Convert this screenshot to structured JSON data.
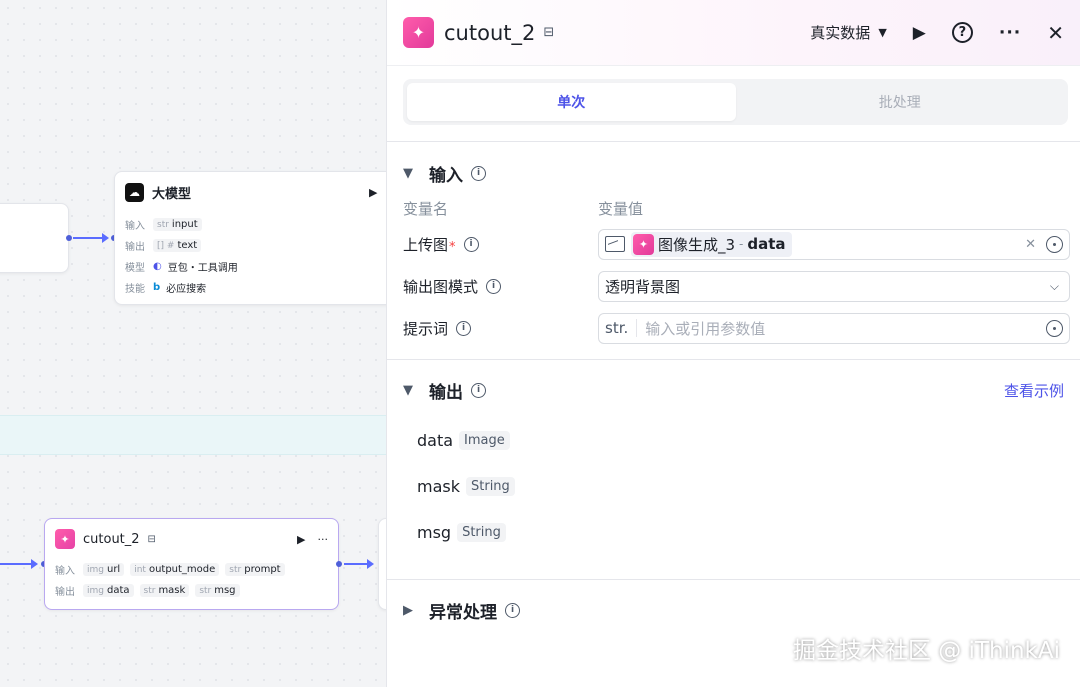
{
  "canvas": {
    "llm_node": {
      "title": "大模型",
      "rows": [
        {
          "label": "输入",
          "tags": [
            {
              "type": "str",
              "name": "input"
            }
          ]
        },
        {
          "label": "输出",
          "tags": [
            {
              "type": "[] #",
              "name": "text"
            }
          ]
        },
        {
          "label": "模型",
          "tags": [
            {
              "type": "",
              "name": "豆包・工具调用"
            }
          ]
        },
        {
          "label": "技能",
          "tags": [
            {
              "type": "",
              "name": "必应搜索"
            }
          ]
        }
      ]
    },
    "cutout_node": {
      "title": "cutout_2",
      "rows": [
        {
          "label": "输入",
          "tags": [
            {
              "type": "img",
              "name": "url"
            },
            {
              "type": "int",
              "name": "output_mode"
            },
            {
              "type": "str",
              "name": "prompt"
            }
          ]
        },
        {
          "label": "输出",
          "tags": [
            {
              "type": "img",
              "name": "data"
            },
            {
              "type": "str",
              "name": "mask"
            },
            {
              "type": "str",
              "name": "msg"
            }
          ]
        }
      ]
    }
  },
  "panel": {
    "title": "cutout_2",
    "data_select": "真实数据",
    "tabs": [
      {
        "label": "单次",
        "active": true
      },
      {
        "label": "批处理",
        "active": false
      }
    ],
    "input_section": {
      "title": "输入",
      "col_name": "变量名",
      "col_value": "变量值",
      "rows": [
        {
          "name": "上传图",
          "required": "*",
          "ref_node": "图像生成_3",
          "ref_sep": "-",
          "ref_field": "data"
        },
        {
          "name": "输出图模式",
          "value": "透明背景图"
        },
        {
          "name": "提示词",
          "prefix": "str.",
          "placeholder": "输入或引用参数值"
        }
      ]
    },
    "output_section": {
      "title": "输出",
      "link": "查看示例",
      "items": [
        {
          "name": "data",
          "type": "Image"
        },
        {
          "name": "mask",
          "type": "String"
        },
        {
          "name": "msg",
          "type": "String"
        }
      ]
    },
    "error_section": {
      "title": "异常处理"
    }
  },
  "watermark": "掘金技术社区 @ iThinkAi"
}
